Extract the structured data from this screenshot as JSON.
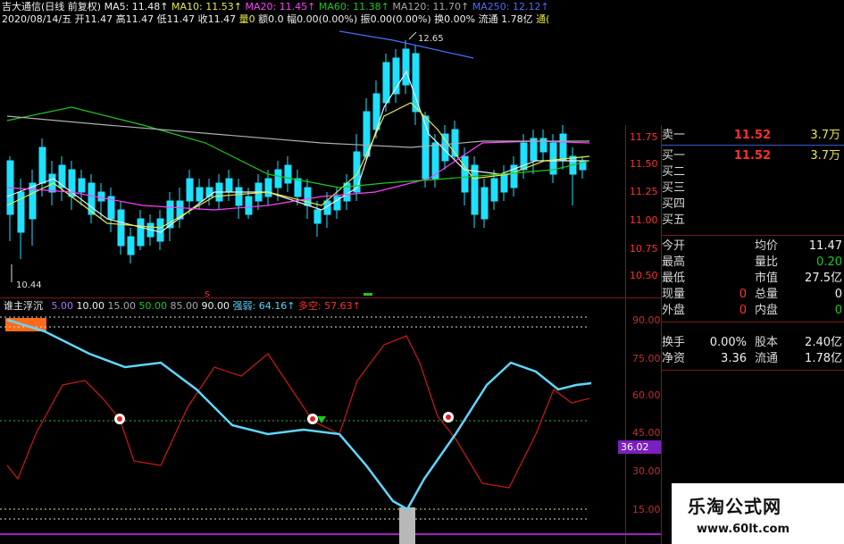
{
  "header": {
    "stock_name": "吉大通信(日线 前复权)",
    "ma5": "MA5: 11.48↑",
    "ma10": "MA10: 11.53↑",
    "ma20": "MA20: 11.45↑",
    "ma60": "MA60: 11.38↑",
    "ma120": "MA120: 11.70↑",
    "ma250": "MA250: 12.12↑",
    "date_line": "2020/08/14/五",
    "open": "开11.47",
    "high": "高11.47",
    "low": "低11.47",
    "close": "收11.47",
    "vol": "量0",
    "amt": "额0.0",
    "change": "幅0.00(0.00%)",
    "amp": "振0.00(0.00%)",
    "turnover": "换0.00%",
    "float": "流通 1.78亿",
    "tail": "通("
  },
  "main_chart": {
    "high_marker": "12.65",
    "low_marker": "10.44",
    "s_marker": "s",
    "price_ticks": [
      "11.75",
      "11.50",
      "11.25",
      "11.00",
      "10.75",
      "10.50"
    ]
  },
  "orderbook": {
    "sell1": {
      "label": "卖一",
      "price": "11.52",
      "vol": "3.7万"
    },
    "buy1": {
      "label": "买一",
      "price": "11.52",
      "vol": "3.7万"
    },
    "buy_levels": [
      "买二",
      "买三",
      "买四",
      "买五"
    ],
    "stats": [
      {
        "l1": "今开",
        "v1": "",
        "l2": "均价",
        "v2": "11.47",
        "c2": "wht"
      },
      {
        "l1": "最高",
        "v1": "",
        "l2": "量比",
        "v2": "0.20",
        "c2": "grn"
      },
      {
        "l1": "最低",
        "v1": "",
        "l2": "市值",
        "v2": "27.5亿",
        "c2": "wht"
      },
      {
        "l1": "现量",
        "v1": "0",
        "l2": "总量",
        "v2": "0",
        "c2": "wht"
      },
      {
        "l1": "外盘",
        "v1": "0",
        "l2": "内盘",
        "v2": "0",
        "c2": "grn"
      }
    ],
    "stats2": [
      {
        "l1": "换手",
        "v1": "0.00%",
        "l2": "股本",
        "v2": "2.40亿"
      },
      {
        "l1": "净资",
        "v1": "3.36",
        "l2": "流通",
        "v2": "1.78亿"
      }
    ]
  },
  "indicator": {
    "name": "谁主浮沉",
    "p1": "5.00",
    "p2": "10.00",
    "p3": "15.00",
    "p4": "50.00",
    "p5": "85.00",
    "p6": "90.00",
    "strong_label": "强弱: 64.16↑",
    "long_short_label": "多空: 57.63↑",
    "axis_ticks": [
      "90.00",
      "75.00",
      "60.00",
      "45.00",
      "30.00",
      "15.00"
    ],
    "current_value": "36.02"
  },
  "colors": {
    "up": "#ff3030",
    "down": "#1ee0ff",
    "strong_line": "#5fd7ff",
    "long_short_line": "#c01818",
    "accent_purple": "#7a20c0"
  },
  "watermark": {
    "title": "乐淘公式网",
    "url": "www.60lt.com"
  }
}
